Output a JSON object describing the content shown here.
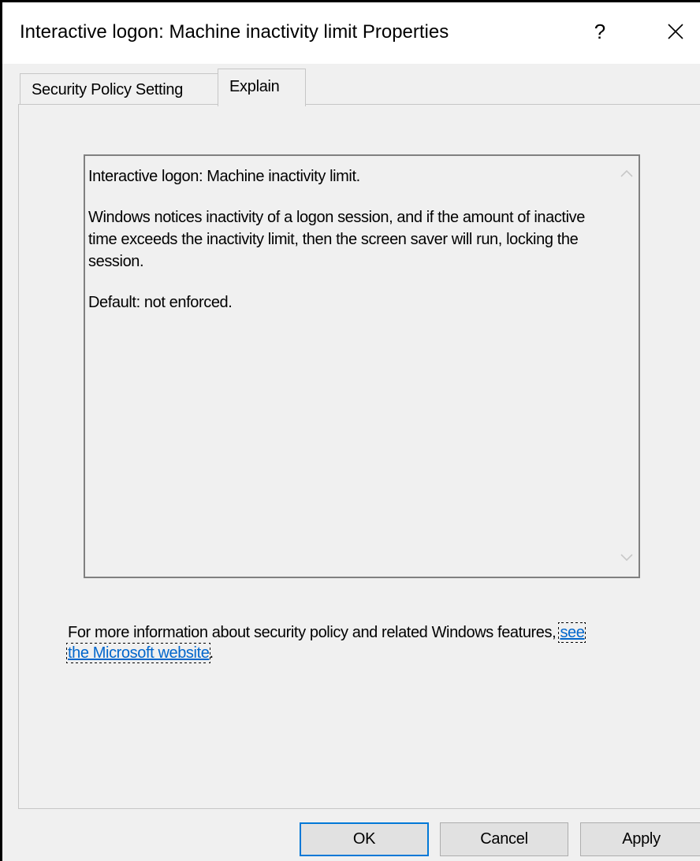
{
  "window": {
    "title": "Interactive logon: Machine inactivity limit Properties",
    "help_label": "?"
  },
  "tabs": [
    {
      "label": "Security Policy Setting",
      "selected": false
    },
    {
      "label": "Explain",
      "selected": true
    }
  ],
  "explain": {
    "paragraphs": [
      "Interactive logon: Machine inactivity limit.",
      "Windows notices inactivity of a logon session, and if the amount of inactive time exceeds the inactivity limit, then the screen saver will run, locking the session.",
      "Default: not enforced."
    ]
  },
  "more_info": {
    "prefix": "For more information about security policy and related Windows features, ",
    "link_text": "see the Microsoft website",
    "suffix": "."
  },
  "buttons": {
    "ok": "OK",
    "cancel": "Cancel",
    "apply": "Apply"
  },
  "colors": {
    "accent": "#0078d7",
    "link": "#0066cc",
    "dialog_bg": "#f0f0f0"
  },
  "icons": {
    "close": "close-icon",
    "scroll_up": "chevron-up-icon",
    "scroll_down": "chevron-down-icon"
  }
}
